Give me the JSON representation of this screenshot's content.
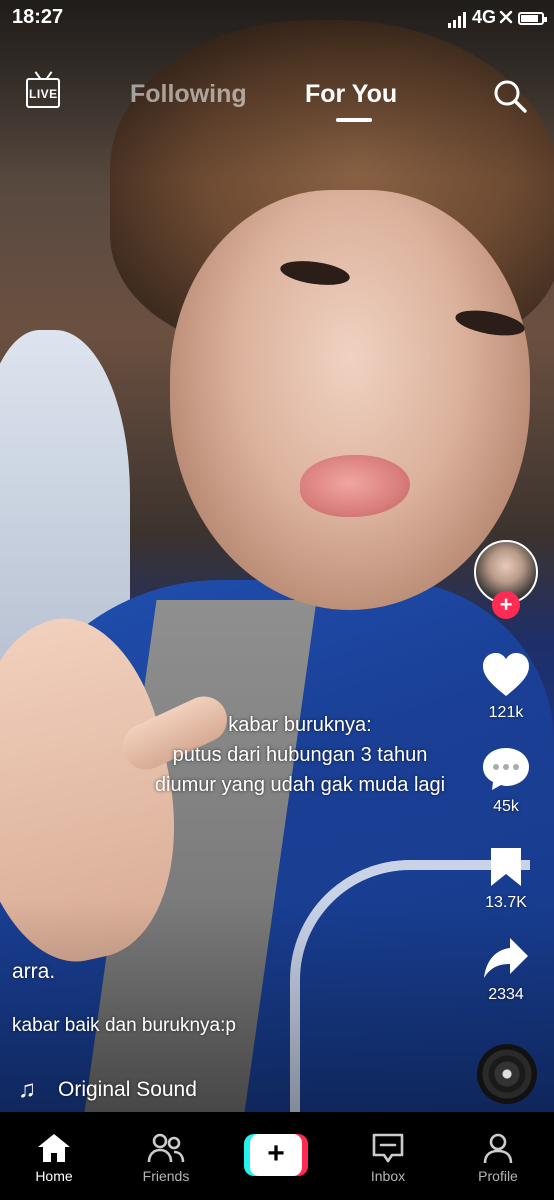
{
  "status_bar": {
    "time": "18:27",
    "network": "4G"
  },
  "top_nav": {
    "live_label": "LIVE",
    "tabs": [
      {
        "label": "Following",
        "active": false
      },
      {
        "label": "For You",
        "active": true
      }
    ]
  },
  "video": {
    "overlay_text": [
      "kabar buruknya:",
      "putus dari hubungan 3 tahun",
      "diumur yang udah gak muda lagi"
    ],
    "author": "arra.",
    "description": "kabar baik dan buruknya:p",
    "sound": "Original Sound"
  },
  "actions": {
    "likes": "121k",
    "comments": "45k",
    "bookmarks": "13.7K",
    "shares": "2334"
  },
  "bottom_nav": {
    "home": "Home",
    "friends": "Friends",
    "create": "+",
    "inbox": "Inbox",
    "profile": "Profile"
  },
  "colors": {
    "accent_red": "#fe2c55",
    "accent_cyan": "#25f4ee"
  }
}
